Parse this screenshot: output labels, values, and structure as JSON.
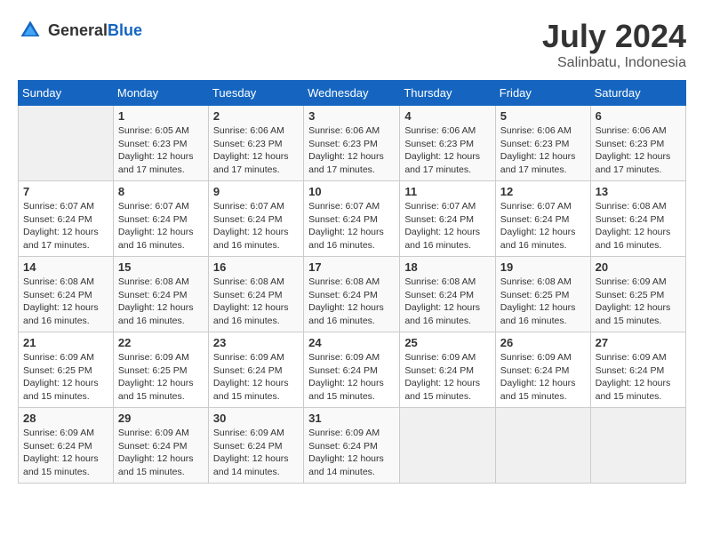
{
  "header": {
    "logo_general": "General",
    "logo_blue": "Blue",
    "month_year": "July 2024",
    "location": "Salinbatu, Indonesia"
  },
  "days_of_week": [
    "Sunday",
    "Monday",
    "Tuesday",
    "Wednesday",
    "Thursday",
    "Friday",
    "Saturday"
  ],
  "weeks": [
    [
      {
        "day": "",
        "sunrise": "",
        "sunset": "",
        "daylight": ""
      },
      {
        "day": "1",
        "sunrise": "Sunrise: 6:05 AM",
        "sunset": "Sunset: 6:23 PM",
        "daylight": "Daylight: 12 hours and 17 minutes."
      },
      {
        "day": "2",
        "sunrise": "Sunrise: 6:06 AM",
        "sunset": "Sunset: 6:23 PM",
        "daylight": "Daylight: 12 hours and 17 minutes."
      },
      {
        "day": "3",
        "sunrise": "Sunrise: 6:06 AM",
        "sunset": "Sunset: 6:23 PM",
        "daylight": "Daylight: 12 hours and 17 minutes."
      },
      {
        "day": "4",
        "sunrise": "Sunrise: 6:06 AM",
        "sunset": "Sunset: 6:23 PM",
        "daylight": "Daylight: 12 hours and 17 minutes."
      },
      {
        "day": "5",
        "sunrise": "Sunrise: 6:06 AM",
        "sunset": "Sunset: 6:23 PM",
        "daylight": "Daylight: 12 hours and 17 minutes."
      },
      {
        "day": "6",
        "sunrise": "Sunrise: 6:06 AM",
        "sunset": "Sunset: 6:23 PM",
        "daylight": "Daylight: 12 hours and 17 minutes."
      }
    ],
    [
      {
        "day": "7",
        "sunrise": "Sunrise: 6:07 AM",
        "sunset": "Sunset: 6:24 PM",
        "daylight": "Daylight: 12 hours and 17 minutes."
      },
      {
        "day": "8",
        "sunrise": "Sunrise: 6:07 AM",
        "sunset": "Sunset: 6:24 PM",
        "daylight": "Daylight: 12 hours and 16 minutes."
      },
      {
        "day": "9",
        "sunrise": "Sunrise: 6:07 AM",
        "sunset": "Sunset: 6:24 PM",
        "daylight": "Daylight: 12 hours and 16 minutes."
      },
      {
        "day": "10",
        "sunrise": "Sunrise: 6:07 AM",
        "sunset": "Sunset: 6:24 PM",
        "daylight": "Daylight: 12 hours and 16 minutes."
      },
      {
        "day": "11",
        "sunrise": "Sunrise: 6:07 AM",
        "sunset": "Sunset: 6:24 PM",
        "daylight": "Daylight: 12 hours and 16 minutes."
      },
      {
        "day": "12",
        "sunrise": "Sunrise: 6:07 AM",
        "sunset": "Sunset: 6:24 PM",
        "daylight": "Daylight: 12 hours and 16 minutes."
      },
      {
        "day": "13",
        "sunrise": "Sunrise: 6:08 AM",
        "sunset": "Sunset: 6:24 PM",
        "daylight": "Daylight: 12 hours and 16 minutes."
      }
    ],
    [
      {
        "day": "14",
        "sunrise": "Sunrise: 6:08 AM",
        "sunset": "Sunset: 6:24 PM",
        "daylight": "Daylight: 12 hours and 16 minutes."
      },
      {
        "day": "15",
        "sunrise": "Sunrise: 6:08 AM",
        "sunset": "Sunset: 6:24 PM",
        "daylight": "Daylight: 12 hours and 16 minutes."
      },
      {
        "day": "16",
        "sunrise": "Sunrise: 6:08 AM",
        "sunset": "Sunset: 6:24 PM",
        "daylight": "Daylight: 12 hours and 16 minutes."
      },
      {
        "day": "17",
        "sunrise": "Sunrise: 6:08 AM",
        "sunset": "Sunset: 6:24 PM",
        "daylight": "Daylight: 12 hours and 16 minutes."
      },
      {
        "day": "18",
        "sunrise": "Sunrise: 6:08 AM",
        "sunset": "Sunset: 6:24 PM",
        "daylight": "Daylight: 12 hours and 16 minutes."
      },
      {
        "day": "19",
        "sunrise": "Sunrise: 6:08 AM",
        "sunset": "Sunset: 6:25 PM",
        "daylight": "Daylight: 12 hours and 16 minutes."
      },
      {
        "day": "20",
        "sunrise": "Sunrise: 6:09 AM",
        "sunset": "Sunset: 6:25 PM",
        "daylight": "Daylight: 12 hours and 15 minutes."
      }
    ],
    [
      {
        "day": "21",
        "sunrise": "Sunrise: 6:09 AM",
        "sunset": "Sunset: 6:25 PM",
        "daylight": "Daylight: 12 hours and 15 minutes."
      },
      {
        "day": "22",
        "sunrise": "Sunrise: 6:09 AM",
        "sunset": "Sunset: 6:25 PM",
        "daylight": "Daylight: 12 hours and 15 minutes."
      },
      {
        "day": "23",
        "sunrise": "Sunrise: 6:09 AM",
        "sunset": "Sunset: 6:24 PM",
        "daylight": "Daylight: 12 hours and 15 minutes."
      },
      {
        "day": "24",
        "sunrise": "Sunrise: 6:09 AM",
        "sunset": "Sunset: 6:24 PM",
        "daylight": "Daylight: 12 hours and 15 minutes."
      },
      {
        "day": "25",
        "sunrise": "Sunrise: 6:09 AM",
        "sunset": "Sunset: 6:24 PM",
        "daylight": "Daylight: 12 hours and 15 minutes."
      },
      {
        "day": "26",
        "sunrise": "Sunrise: 6:09 AM",
        "sunset": "Sunset: 6:24 PM",
        "daylight": "Daylight: 12 hours and 15 minutes."
      },
      {
        "day": "27",
        "sunrise": "Sunrise: 6:09 AM",
        "sunset": "Sunset: 6:24 PM",
        "daylight": "Daylight: 12 hours and 15 minutes."
      }
    ],
    [
      {
        "day": "28",
        "sunrise": "Sunrise: 6:09 AM",
        "sunset": "Sunset: 6:24 PM",
        "daylight": "Daylight: 12 hours and 15 minutes."
      },
      {
        "day": "29",
        "sunrise": "Sunrise: 6:09 AM",
        "sunset": "Sunset: 6:24 PM",
        "daylight": "Daylight: 12 hours and 15 minutes."
      },
      {
        "day": "30",
        "sunrise": "Sunrise: 6:09 AM",
        "sunset": "Sunset: 6:24 PM",
        "daylight": "Daylight: 12 hours and 14 minutes."
      },
      {
        "day": "31",
        "sunrise": "Sunrise: 6:09 AM",
        "sunset": "Sunset: 6:24 PM",
        "daylight": "Daylight: 12 hours and 14 minutes."
      },
      {
        "day": "",
        "sunrise": "",
        "sunset": "",
        "daylight": ""
      },
      {
        "day": "",
        "sunrise": "",
        "sunset": "",
        "daylight": ""
      },
      {
        "day": "",
        "sunrise": "",
        "sunset": "",
        "daylight": ""
      }
    ]
  ]
}
